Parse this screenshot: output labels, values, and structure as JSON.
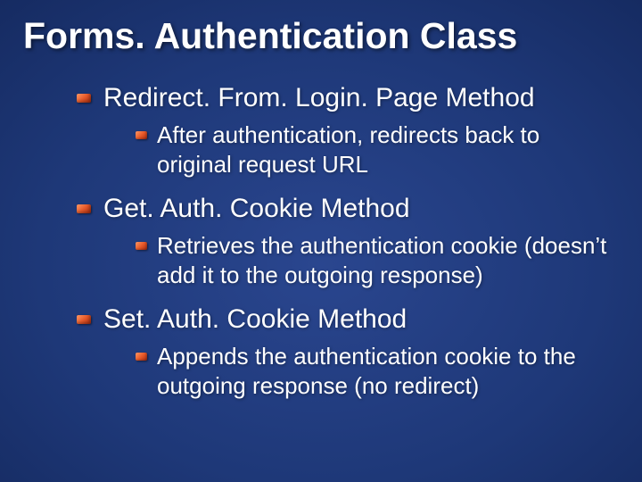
{
  "title": "Forms. Authentication Class",
  "items": [
    {
      "label": "Redirect. From. Login. Page Method",
      "sub": [
        {
          "label": "After authentication, redirects back to original request URL"
        }
      ]
    },
    {
      "label": "Get. Auth. Cookie Method",
      "sub": [
        {
          "label": "Retrieves the authentication cookie (doesn’t add it to the outgoing response)"
        }
      ]
    },
    {
      "label": "Set. Auth. Cookie Method",
      "sub": [
        {
          "label": "Appends the authentication cookie to the outgoing response (no redirect)"
        }
      ]
    }
  ]
}
